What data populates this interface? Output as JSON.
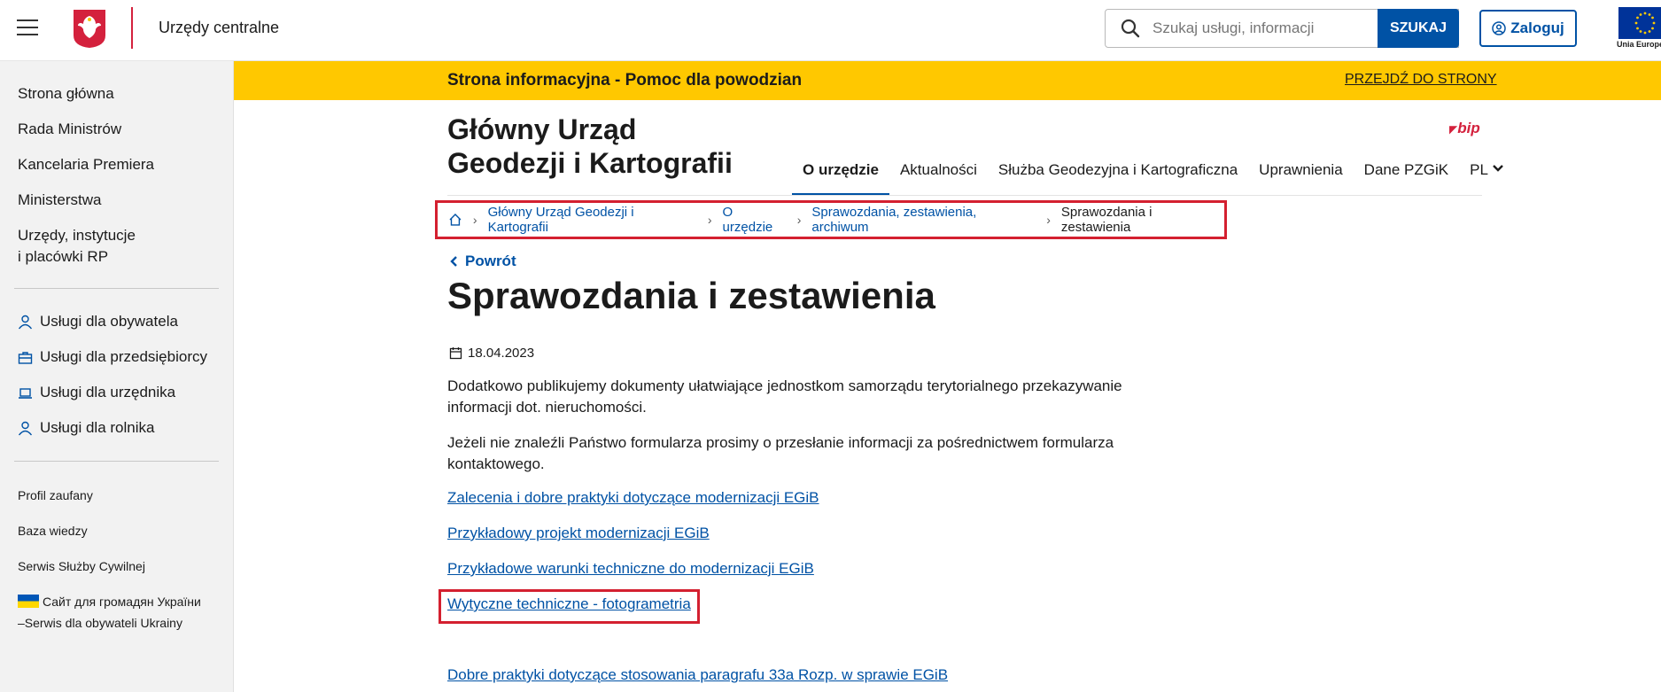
{
  "header": {
    "site_name": "Urzędy centralne",
    "search_placeholder": "Szukaj usługi, informacji",
    "search_button": "SZUKAJ",
    "login_button": "Zaloguj",
    "eu_label": "Unia Europejska"
  },
  "sidebar": {
    "main_items": [
      "Strona główna",
      "Rada Ministrów",
      "Kancelaria Premiera",
      "Ministerstwa",
      "Urzędy, instytucje",
      "i placówki RP"
    ],
    "service_items": [
      "Usługi dla obywatela",
      "Usługi dla przedsiębiorcy",
      "Usługi dla urzędnika",
      "Usługi dla rolnika"
    ],
    "extra_items": [
      "Profil zaufany",
      "Baza wiedzy",
      "Serwis Służby Cywilnej",
      "Сайт для громадян України",
      "–Serwis dla obywateli Ukrainy"
    ]
  },
  "banner": {
    "title": "Strona informacyjna - Pomoc dla powodzian",
    "link": "PRZEJDŹ DO STRONY"
  },
  "org": {
    "title_line1": "Główny Urząd",
    "title_line2": "Geodezji i Kartografii",
    "bip": "bip"
  },
  "nav": [
    "O urzędzie",
    "Aktualności",
    "Służba Geodezyjna i Kartograficzna",
    "Uprawnienia",
    "Dane PZGiK",
    "PL"
  ],
  "breadcrumb": [
    "Główny Urząd Geodezji i Kartografii",
    "O urzędzie",
    "Sprawozdania, zestawienia, archiwum",
    "Sprawozdania i zestawienia"
  ],
  "content": {
    "back": "Powrót",
    "title": "Sprawozdania i zestawienia",
    "date": "18.04.2023",
    "para1_line1": "Dodatkowo publikujemy dokumenty ułatwiające jednostkom samorządu terytorialnego przekazywanie",
    "para1_line2": "informacji dot. nieruchomości.",
    "para2_line1": "Jeżeli nie znaleźli Państwo formularza prosimy o przesłanie informacji za pośrednictwem formularza",
    "para2_line2": "kontaktowego.",
    "links": [
      "Zalecenia i dobre praktyki dotyczące modernizacji EGiB",
      "Przykładowy projekt modernizacji EGiB",
      "Przykładowe warunki techniczne do modernizacji EGiB",
      "Wytyczne techniczne - fotogrametria",
      "Dobre praktyki dotyczące stosowania paragrafu 33a Rozp. w sprawie EGiB"
    ]
  },
  "colors": {
    "brand_blue": "#0052a5",
    "banner_yellow": "#ffc800",
    "highlight_red": "#d42030"
  }
}
